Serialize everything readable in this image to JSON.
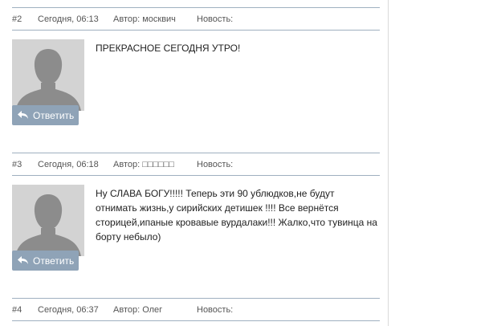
{
  "comments": [
    {
      "number": "#2",
      "date": "Сегодня, 06:13",
      "author": "Автор: москвич",
      "news": "Новость:",
      "text": "ПРЕКРАСНОЕ СЕГОДНЯ УТРО!",
      "reply_label": "Ответить"
    },
    {
      "number": "#3",
      "date": "Сегодня, 06:18",
      "author": "Автор: □□□□□□",
      "news": "Новость:",
      "text": "Ну СЛАВА БОГУ!!!!! Теперь эти 90 ублюдков,не будут отнимать жизнь,у сирийских детишек !!!! Все вернётся сторицей,ипаные кровавые вурдалаки!!! Жалко,что тувинца на борту небыло)",
      "reply_label": "Ответить"
    },
    {
      "number": "#4",
      "date": "Сегодня, 06:37",
      "author": "Автор: Олег",
      "news": "Новость:"
    }
  ],
  "colors": {
    "reply_button_bg": "#8fa3b7",
    "divider": "#9fb0c0",
    "avatar_bg": "#d3d3d3",
    "avatar_silhouette": "#8c8c8c"
  },
  "icons": {
    "reply": "reply-arrow-icon",
    "avatar": "default-user-silhouette"
  }
}
